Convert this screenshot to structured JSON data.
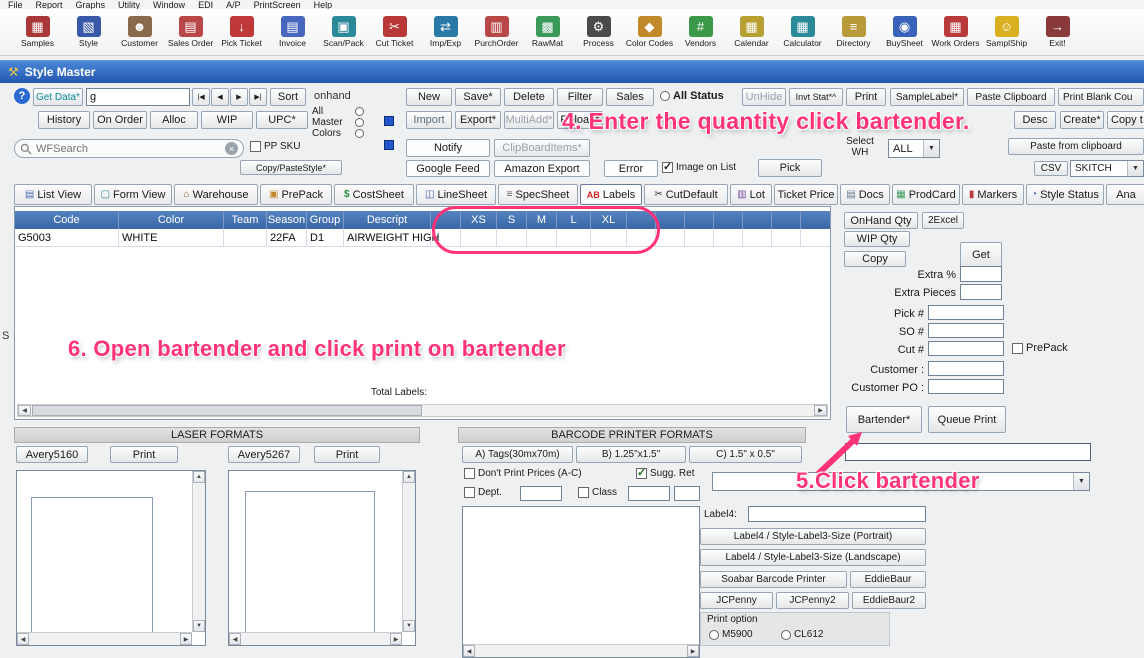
{
  "colors": {
    "annotation_pink": "#ff3377",
    "titlebar_blue": "#2f62b8",
    "table_header_blue": "#4a76b4"
  },
  "menubar": {
    "items": [
      "File",
      "Report",
      "Graphs",
      "Utility",
      "Window",
      "EDI",
      "A/P",
      "PrintScreen",
      "Help"
    ]
  },
  "toolbar": {
    "items": [
      {
        "label": "Samples",
        "icon": "samples-icon",
        "glyph": "▦"
      },
      {
        "label": "Style",
        "icon": "style-icon",
        "glyph": "▧"
      },
      {
        "label": "Customer",
        "icon": "customer-icon",
        "glyph": "☻"
      },
      {
        "label": "Sales Order",
        "icon": "sales-order-icon",
        "glyph": "▤"
      },
      {
        "label": "Pick Ticket",
        "icon": "pick-ticket-icon",
        "glyph": "↓"
      },
      {
        "label": "Invoice",
        "icon": "invoice-icon",
        "glyph": "▤"
      },
      {
        "label": "Scan/Pack",
        "icon": "scan-pack-icon",
        "glyph": "▣"
      },
      {
        "label": "Cut Ticket",
        "icon": "cut-ticket-icon",
        "glyph": "✂"
      },
      {
        "label": "Imp/Exp",
        "icon": "import-export-icon",
        "glyph": "⇄"
      },
      {
        "label": "PurchOrder",
        "icon": "purchase-order-icon",
        "glyph": "▥"
      },
      {
        "label": "RawMat",
        "icon": "raw-materials-icon",
        "glyph": "▩"
      },
      {
        "label": "Process",
        "icon": "process-icon",
        "glyph": "⚙"
      },
      {
        "label": "Color Codes",
        "icon": "color-codes-icon",
        "glyph": "◆"
      },
      {
        "label": "Vendors",
        "icon": "vendors-icon",
        "glyph": "#"
      },
      {
        "label": "Calendar",
        "icon": "calendar-icon",
        "glyph": "▦"
      },
      {
        "label": "Calculator",
        "icon": "calculator-icon",
        "glyph": "▦"
      },
      {
        "label": "Directory",
        "icon": "directory-icon",
        "glyph": "≡"
      },
      {
        "label": "BuySheet",
        "icon": "buysheet-icon",
        "glyph": "◉"
      },
      {
        "label": "Work Orders",
        "icon": "work-orders-icon",
        "glyph": "▦"
      },
      {
        "label": "SamplShip",
        "icon": "sample-ship-icon",
        "glyph": "☺"
      },
      {
        "label": "Exit!",
        "icon": "exit-icon",
        "glyph": "→"
      }
    ]
  },
  "titlebar": {
    "title": "Style Master",
    "glyph": "⚒"
  },
  "controls": {
    "help": "?",
    "get_data": "Get Data*",
    "get_data_value": "g",
    "nav_first": "|◀",
    "nav_prev": "◀",
    "nav_next": "▶",
    "nav_last": "▶|",
    "sort": "Sort",
    "onhand": "onhand",
    "new_btn": "New",
    "save": "Save*",
    "del": "Delete",
    "filter": "Filter",
    "sales": "Sales",
    "all_status": "All Status",
    "unhide": "UnHide",
    "invt_stat": "Invt Stat*^",
    "print": "Print",
    "sample_label": "SampleLabel*",
    "paste_clipboard": "Paste Clipboard",
    "print_blank": "Print Blank Cou",
    "history": "History",
    "on_order": "On Order",
    "alloc": "Alloc",
    "wip": "WIP",
    "upc": "UPC*",
    "radio_all": "All",
    "radio_master": "Master",
    "radio_colors": "Colors",
    "import_btn": "Import",
    "export": "Export*",
    "multi_add": "MultiAdd*",
    "reload": "Reload*",
    "desc": "Desc",
    "create": "Create*",
    "copy_to": "Copy t",
    "search_placeholder": "WFSearch",
    "pp_sku": "PP SKU",
    "notify": "Notify",
    "clipboard_items": "ClipBoardItems*",
    "select_wh": "Select WH",
    "wh_value": "ALL",
    "paste_from_clipboard": "Paste from clipboard",
    "copy_paste_style": "Copy/PasteStyle*",
    "google_feed": "Google Feed",
    "amazon_export": "Amazon Export",
    "error": "Error",
    "image_on_list": "Image on List",
    "pick": "Pick",
    "csv": "CSV",
    "skitch": "SKITCH"
  },
  "tabs": [
    {
      "label": "List View",
      "icon": "list-view-icon",
      "glyph": "▤"
    },
    {
      "label": "Form View",
      "icon": "form-view-icon",
      "glyph": "▢"
    },
    {
      "label": "Warehouse",
      "icon": "warehouse-icon",
      "glyph": "⌂"
    },
    {
      "label": "PrePack",
      "icon": "prepack-icon",
      "glyph": "▣"
    },
    {
      "label": "CostSheet",
      "icon": "costsheet-icon",
      "glyph": "$"
    },
    {
      "label": "LineSheet",
      "icon": "linesheet-icon",
      "glyph": "◫"
    },
    {
      "label": "SpecSheet",
      "icon": "specsheet-icon",
      "glyph": "≡"
    },
    {
      "label": "Labels",
      "icon": "labels-ab-icon",
      "glyph": "AB"
    },
    {
      "label": "CutDefault",
      "icon": "cutdefault-icon",
      "glyph": "✂"
    },
    {
      "label": "Lot",
      "icon": "lot-icon",
      "glyph": "▥"
    },
    {
      "label": "Ticket Price",
      "icon": "ticket-price-icon",
      "glyph": ""
    },
    {
      "label": "Docs",
      "icon": "docs-icon",
      "glyph": "▤"
    },
    {
      "label": "ProdCard",
      "icon": "prodcard-icon",
      "glyph": "▦"
    },
    {
      "label": "Markers",
      "icon": "markers-icon",
      "glyph": "▮"
    },
    {
      "label": "Style Status",
      "icon": "style-status-icon",
      "glyph": "◔"
    },
    {
      "label": "Ana",
      "icon": "analysis-icon",
      "glyph": ""
    }
  ],
  "table": {
    "columns": [
      "Code",
      "Color",
      "Team",
      "Season",
      "Group",
      "Descript",
      "",
      "XS",
      "S",
      "M",
      "L",
      "XL"
    ],
    "row": [
      "G5003",
      "WHITE",
      "",
      "22FA",
      "D1",
      "AIRWEIGHT HIGH",
      "",
      "",
      "",
      "",
      "",
      ""
    ],
    "total_labels": "Total Labels:"
  },
  "right_panel": {
    "onhand_qty": "OnHand Qty",
    "to_excel": "2Excel",
    "wip_qty": "WIP Qty",
    "copy": "Copy",
    "get": "Get",
    "extra_pct": "Extra %",
    "extra_pieces": "Extra Pieces",
    "pick_no": "Pick #",
    "so_no": "SO #",
    "cut_no": "Cut #",
    "prepack": "PrePack",
    "customer": "Customer :",
    "customer_po": "Customer PO :",
    "bartender": "Bartender*",
    "queue_print": "Queue Print"
  },
  "annotations": {
    "step4": "4. Enter the quantity click bartender.",
    "step5": "5.Click bartender",
    "step6": "6. Open bartender and click print on bartender"
  },
  "bottom": {
    "laser_header": "LASER FORMATS",
    "avery5160": "Avery5160",
    "print_a": "Print",
    "avery5267": "Avery5267",
    "print_b": "Print",
    "barcode_header": "BARCODE PRINTER FORMATS",
    "tags_a": "A) Tags(30mx70m)",
    "tags_b": "B) 1.25\"x1.5\"",
    "tags_c": "C) 1.5\" x 0.5\"",
    "dont_print_prices": "Don't Print Prices (A-C)",
    "sugg_ret": "Sugg. Ret",
    "dept": "Dept.",
    "class": "Class",
    "label4": "Label4:",
    "portrait": "Label4 / Style-Label3-Size (Portrait)",
    "landscape": "Label4 / Style-Label3-Size (Landscape)",
    "soabar": "Soabar Barcode Printer",
    "eddiebaur": "EddieBaur",
    "jcpenny": "JCPenny",
    "jcpenny2": "JCPenny2",
    "eddiebaur2": "EddieBaur2",
    "print_option": "Print option",
    "m5900": "M5900",
    "cl612": "CL612"
  },
  "side": {
    "letter": "S"
  }
}
